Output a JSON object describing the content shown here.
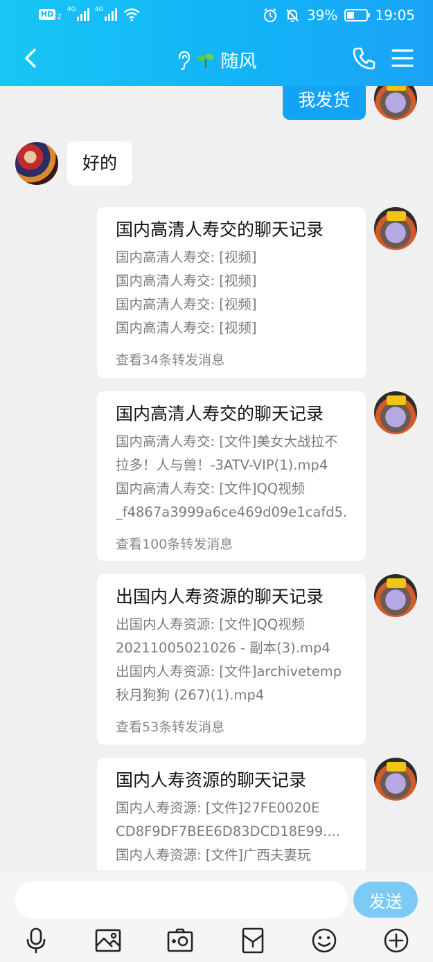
{
  "status_bar": {
    "left_badge": "HD",
    "left_badge_sub": "2",
    "signal1_label": "4G",
    "signal2_label": "4G",
    "battery_text": "39%",
    "battery_level": 0.39,
    "time": "19:05"
  },
  "header": {
    "title": "随风",
    "icons": [
      "back-arrow-icon",
      "ear-icon",
      "sprout-icon",
      "phone-icon",
      "menu-icon"
    ]
  },
  "messages": {
    "m1": {
      "text": "我发货"
    },
    "m2": {
      "text": "好的"
    },
    "cards": [
      {
        "title": "国内高清人寿交的聊天记录",
        "lines": [
          "国内高清人寿交: [视频]",
          "国内高清人寿交: [视频]",
          "国内高清人寿交: [视频]",
          "国内高清人寿交: [视频]"
        ],
        "footer": "查看34条转发消息"
      },
      {
        "title": "国内高清人寿交的聊天记录",
        "lines": [
          "国内高清人寿交: [文件]美女大战拉不",
          "拉多！人与兽！-3ATV-VIP(1).mp4",
          "国内高清人寿交: [文件]QQ视频",
          "_f4867a3999a6ce469d09e1cafd5..."
        ],
        "footer": "查看100条转发消息"
      },
      {
        "title": "出国内人寿资源的聊天记录",
        "lines": [
          "出国内人寿资源: [文件]QQ视频",
          "20211005021026 - 副本(3).mp4",
          "出国内人寿资源: [文件]archivetemp",
          "秋月狗狗 (267)(1).mp4"
        ],
        "footer": "查看53条转发消息"
      },
      {
        "title": "国内人寿资源的聊天记录",
        "lines": [
          "国内人寿资源: [文件]27FE0020E",
          "CD8F9DF7BEE6D83DCD18E99....",
          "国内人寿资源: [文件]广西夫妻玩"
        ]
      }
    ]
  },
  "composer": {
    "input_value": "",
    "send_label": "发送"
  },
  "toolbar_icons": [
    "microphone-icon",
    "image-icon",
    "camera-icon",
    "red-packet-icon",
    "emoji-icon",
    "plus-icon"
  ],
  "colors": {
    "header_start": "#18c6f5",
    "header_end": "#1aa2f6",
    "my_bubble": "#12a3f6",
    "send_button": "#7ccbf7",
    "background": "#f0f0f0"
  }
}
